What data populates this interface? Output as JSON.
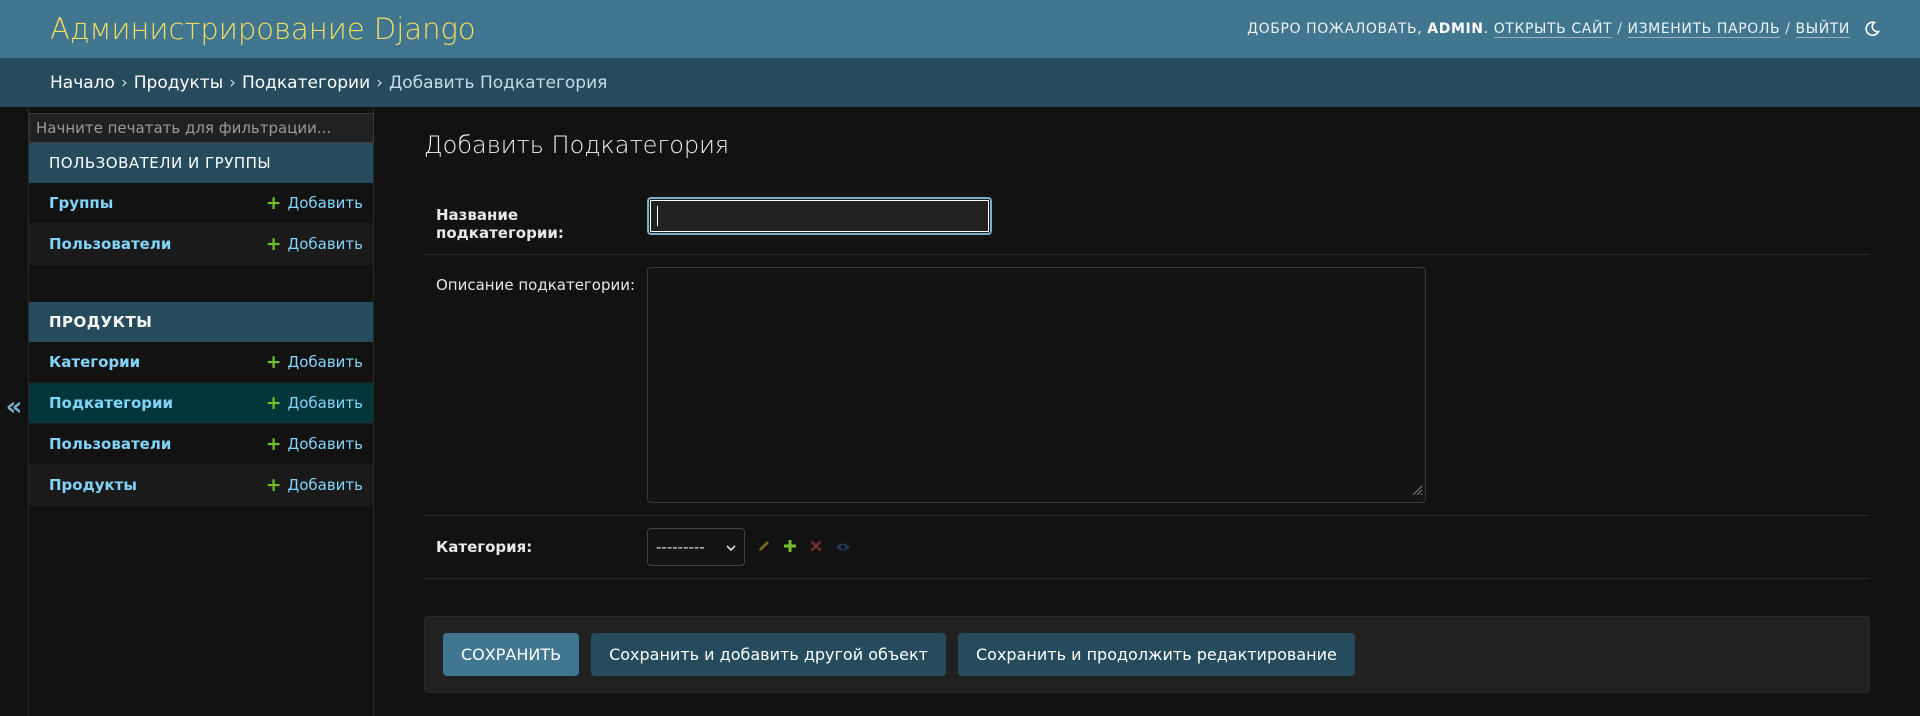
{
  "header": {
    "brand": "Администрирование Django",
    "welcome": "Добро пожаловать,",
    "username": "admin",
    "open_site": "Открыть сайт",
    "change_password": "Изменить пароль",
    "logout": "Выйти",
    "separator": "/"
  },
  "breadcrumbs": {
    "items": [
      "Начало",
      "Продукты",
      "Подкатегории"
    ],
    "current": "Добавить Подкатегория",
    "separator": "›"
  },
  "sidebar": {
    "toggle": "«",
    "filter_placeholder": "Начните печатать для фильтрации...",
    "modules": [
      {
        "caption": "Пользователи и группы",
        "rows": [
          {
            "label": "Группы",
            "add": "Добавить"
          },
          {
            "label": "Пользователи",
            "add": "Добавить"
          }
        ]
      },
      {
        "caption": "Продукты",
        "rows": [
          {
            "label": "Категории",
            "add": "Добавить"
          },
          {
            "label": "Подкатегории",
            "add": "Добавить"
          },
          {
            "label": "Пользователи",
            "add": "Добавить"
          },
          {
            "label": "Продукты",
            "add": "Добавить"
          }
        ]
      }
    ]
  },
  "form": {
    "title": "Добавить Подкатегория",
    "name_label": "Название подкатегории:",
    "name_value": "",
    "description_label": "Описание подкатегории:",
    "category_label": "Категория:",
    "category_selected": "---------",
    "buttons": {
      "save": "Сохранить",
      "save_add_another": "Сохранить и добавить другой объект",
      "save_continue": "Сохранить и продолжить редактирование"
    }
  },
  "colors": {
    "header_bg": "#417690",
    "brand": "#f5dd5d",
    "breadcrumbs_bg": "#264b5d",
    "link": "#81d4fa",
    "add_plus": "#70bf2b",
    "current_row": "#00363a"
  }
}
